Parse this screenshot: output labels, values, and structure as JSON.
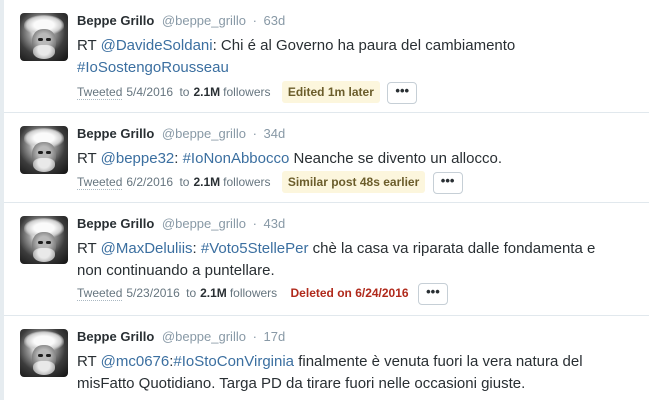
{
  "tweets": [
    {
      "name": "Beppe Grillo",
      "handle": "@beppe_grillo",
      "age": "63d",
      "text": {
        "prefix": "RT ",
        "mention": "@DavideSoldani",
        "rest": ": Chi é al Governo ha paura del cambiamento",
        "line2_hashtag": "#IoSostengoRousseau"
      },
      "meta": {
        "tweeted": "Tweeted",
        "date": "5/4/2016",
        "to": "to",
        "followers_count": "2.1M",
        "followers_label": "followers",
        "badge": "Edited 1m later",
        "badge_type": "edited",
        "more": "•••"
      }
    },
    {
      "name": "Beppe Grillo",
      "handle": "@beppe_grillo",
      "age": "34d",
      "text": {
        "prefix": "RT ",
        "mention": "@beppe32",
        "sep": ": ",
        "hashtag": "#IoNonAbbocco",
        "rest": " Neanche se divento un allocco."
      },
      "meta": {
        "tweeted": "Tweeted",
        "date": "6/2/2016",
        "to": "to",
        "followers_count": "2.1M",
        "followers_label": "followers",
        "badge": "Similar post 48s earlier",
        "badge_type": "similar",
        "more": "•••"
      }
    },
    {
      "name": "Beppe Grillo",
      "handle": "@beppe_grillo",
      "age": "43d",
      "text": {
        "prefix": "RT ",
        "mention": "@MaxDeluliis",
        "sep": ": ",
        "hashtag": "#Voto5StellePer",
        "rest": " chè la casa va riparata dalle fondamenta e",
        "line2": "non continuando a puntellare."
      },
      "meta": {
        "tweeted": "Tweeted",
        "date": "5/23/2016",
        "to": "to",
        "followers_count": "2.1M",
        "followers_label": "followers",
        "badge": "Deleted on 6/24/2016",
        "badge_type": "deleted",
        "more": "•••"
      }
    },
    {
      "name": "Beppe Grillo",
      "handle": "@beppe_grillo",
      "age": "17d",
      "text": {
        "prefix": "RT ",
        "mention": "@mc0676",
        "sep": ":",
        "hashtag": "#IoStoConVirginia",
        "rest": " finalmente è venuta fuori la vera natura del",
        "line2": "misFatto Quotidiano. Targa PD da tirare fuori nelle occasioni giuste."
      }
    }
  ]
}
